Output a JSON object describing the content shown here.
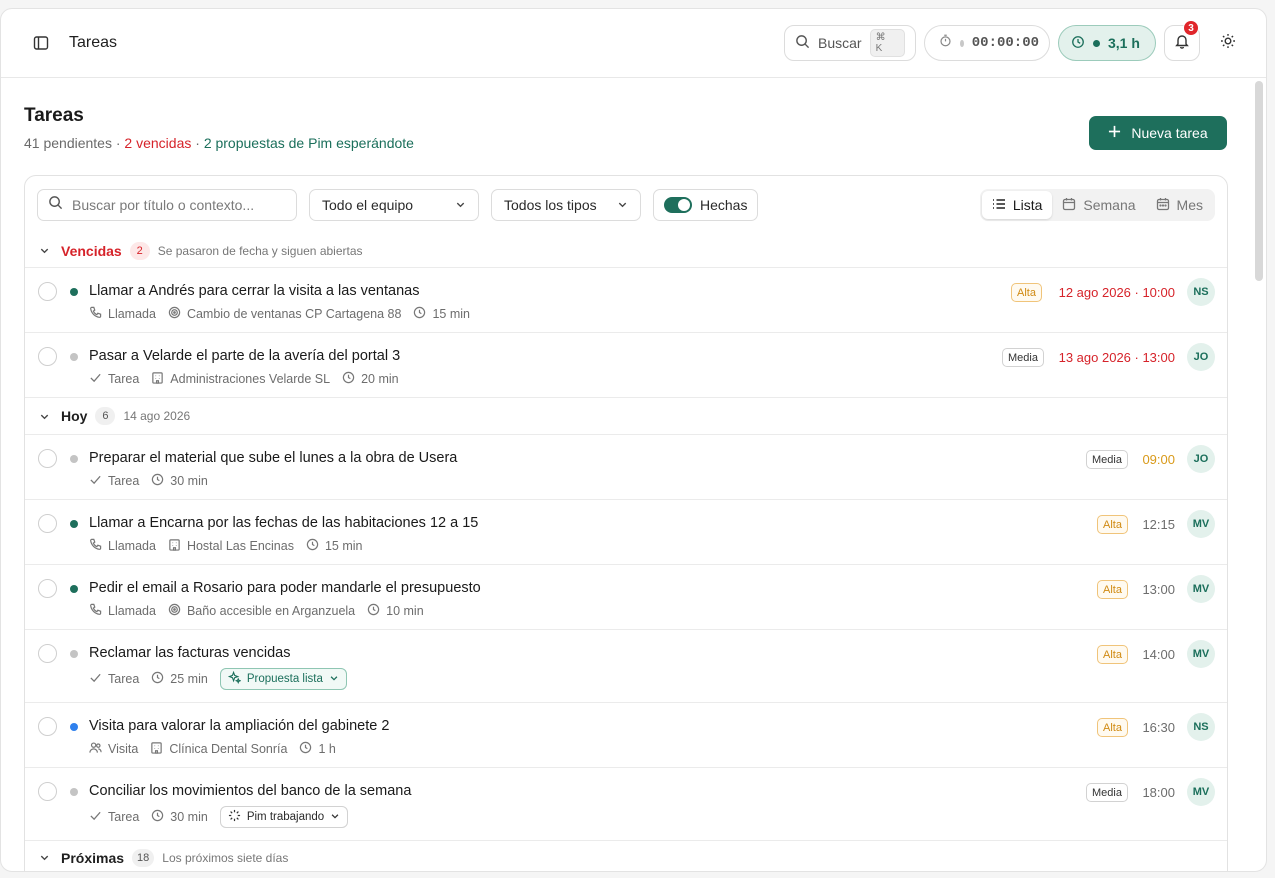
{
  "header": {
    "title": "Tareas",
    "search_label": "Buscar",
    "search_shortcut": "⌘ K",
    "timer": "00:00:00",
    "hours": "3,1 h",
    "notifications_count": "3"
  },
  "page": {
    "title": "Tareas",
    "pending": "41 pendientes",
    "sep": " · ",
    "overdue": "2 vencidas",
    "proposals": "2 propuestas de Pim esperándote",
    "new_task_label": "Nueva tarea"
  },
  "filters": {
    "search_placeholder": "Buscar por título o contexto...",
    "team": "Todo el equipo",
    "types": "Todos los tipos",
    "done_label": "Hechas",
    "views": [
      "Lista",
      "Semana",
      "Mes"
    ]
  },
  "groups": [
    {
      "label": "Vencidas",
      "count": "2",
      "note": "Se pasaron de fecha y siguen abiertas",
      "tasks": [
        {
          "title": "Llamar a Andrés para cerrar la visita a las ventanas",
          "type": "Llamada",
          "context": "Cambio de ventanas CP Cartagena 88",
          "duration": "15 min",
          "priority": "Alta",
          "date": "12 ago 2026 · 10:00",
          "assignee": "NS"
        },
        {
          "title": "Pasar a Velarde el parte de la avería del portal 3",
          "type": "Tarea",
          "context": "Administraciones Velarde SL",
          "duration": "20 min",
          "priority": "Media",
          "date": "13 ago 2026 · 13:00",
          "assignee": "JO"
        }
      ]
    },
    {
      "label": "Hoy",
      "count": "6",
      "note": "14 ago 2026",
      "tasks": [
        {
          "title": "Preparar el material que sube el lunes a la obra de Usera",
          "type": "Tarea",
          "duration": "30 min",
          "priority": "Media",
          "date": "09:00",
          "assignee": "JO"
        },
        {
          "title": "Llamar a Encarna por las fechas de las habitaciones 12 a 15",
          "type": "Llamada",
          "context": "Hostal Las Encinas",
          "duration": "15 min",
          "priority": "Alta",
          "date": "12:15",
          "assignee": "MV"
        },
        {
          "title": "Pedir el email a Rosario para poder mandarle el presupuesto",
          "type": "Llamada",
          "context": "Baño accesible en Arganzuela",
          "duration": "10 min",
          "priority": "Alta",
          "date": "13:00",
          "assignee": "MV"
        },
        {
          "title": "Reclamar las facturas vencidas",
          "type": "Tarea",
          "duration": "25 min",
          "chip": "Propuesta lista",
          "priority": "Alta",
          "date": "14:00",
          "assignee": "MV"
        },
        {
          "title": "Visita para valorar la ampliación del gabinete 2",
          "type": "Visita",
          "context": "Clínica Dental Sonría",
          "duration": "1 h",
          "priority": "Alta",
          "date": "16:30",
          "assignee": "NS"
        },
        {
          "title": "Conciliar los movimientos del banco de la semana",
          "type": "Tarea",
          "duration": "30 min",
          "chip": "Pim trabajando",
          "priority": "Media",
          "date": "18:00",
          "assignee": "MV"
        }
      ]
    },
    {
      "label": "Próximas",
      "count": "18",
      "note": "Los próximos siete días",
      "tasks": []
    }
  ],
  "colors": {
    "accent": "#1e6f5c",
    "danger": "#d6232a",
    "warning": "#d08a12",
    "info": "#2f80ed"
  }
}
